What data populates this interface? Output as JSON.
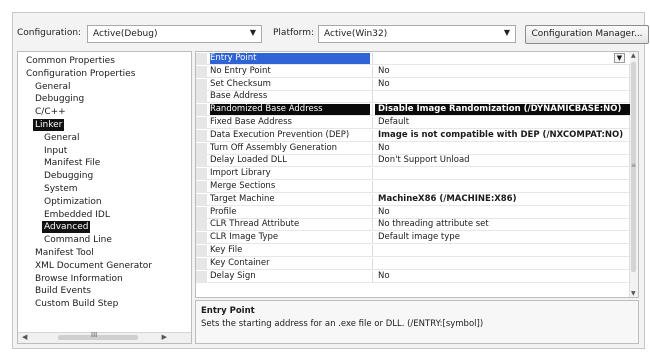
{
  "toolbar": {
    "configuration_label": "Configuration:",
    "configuration_value": "Active(Debug)",
    "platform_label": "Platform:",
    "platform_value": "Active(Win32)",
    "config_manager_button": "Configuration Manager..."
  },
  "tree": {
    "items": [
      {
        "label": "Common Properties",
        "level": 1
      },
      {
        "label": "Configuration Properties",
        "level": 1
      },
      {
        "label": "General",
        "level": 2
      },
      {
        "label": "Debugging",
        "level": 2
      },
      {
        "label": "C/C++",
        "level": 2
      },
      {
        "label": "Linker",
        "level": 2,
        "selected": true
      },
      {
        "label": "General",
        "level": 3
      },
      {
        "label": "Input",
        "level": 3
      },
      {
        "label": "Manifest File",
        "level": 3
      },
      {
        "label": "Debugging",
        "level": 3
      },
      {
        "label": "System",
        "level": 3
      },
      {
        "label": "Optimization",
        "level": 3
      },
      {
        "label": "Embedded IDL",
        "level": 3
      },
      {
        "label": "Advanced",
        "level": 3,
        "selected": true
      },
      {
        "label": "Command Line",
        "level": 3
      },
      {
        "label": "Manifest Tool",
        "level": 2
      },
      {
        "label": "XML Document Generator",
        "level": 2
      },
      {
        "label": "Browse Information",
        "level": 2
      },
      {
        "label": "Build Events",
        "level": 2
      },
      {
        "label": "Custom Build Step",
        "level": 2
      }
    ],
    "scroll_grip": "III"
  },
  "grid": {
    "rows": [
      {
        "key": "Entry Point",
        "value": "",
        "state": "focused"
      },
      {
        "key": "No Entry Point",
        "value": "No"
      },
      {
        "key": "Set Checksum",
        "value": "No"
      },
      {
        "key": "Base Address",
        "value": ""
      },
      {
        "key": "Randomized Base Address",
        "value": "Disable Image Randomization (/DYNAMICBASE:NO)",
        "state": "highlighted",
        "bold": true
      },
      {
        "key": "Fixed Base Address",
        "value": "Default"
      },
      {
        "key": "Data Execution Prevention (DEP)",
        "value": "Image is not compatible with DEP (/NXCOMPAT:NO)",
        "bold": true
      },
      {
        "key": "Turn Off Assembly Generation",
        "value": "No"
      },
      {
        "key": "Delay Loaded DLL",
        "value": "Don't Support Unload"
      },
      {
        "key": "Import Library",
        "value": ""
      },
      {
        "key": "Merge Sections",
        "value": ""
      },
      {
        "key": "Target Machine",
        "value": "MachineX86 (/MACHINE:X86)",
        "bold": true
      },
      {
        "key": "Profile",
        "value": "No"
      },
      {
        "key": "CLR Thread Attribute",
        "value": "No threading attribute set"
      },
      {
        "key": "CLR Image Type",
        "value": "Default image type"
      },
      {
        "key": "Key File",
        "value": ""
      },
      {
        "key": "Key Container",
        "value": ""
      },
      {
        "key": "Delay Sign",
        "value": "No"
      }
    ]
  },
  "description": {
    "title": "Entry Point",
    "text": "Sets the starting address for an .exe file or DLL.   (/ENTRY:[symbol])"
  },
  "icons": {
    "dropdown": "chevron-down-icon",
    "scroll_up": "arrow-up-icon",
    "scroll_down": "arrow-down-icon",
    "scroll_left": "arrow-left-icon",
    "scroll_right": "arrow-right-icon"
  }
}
